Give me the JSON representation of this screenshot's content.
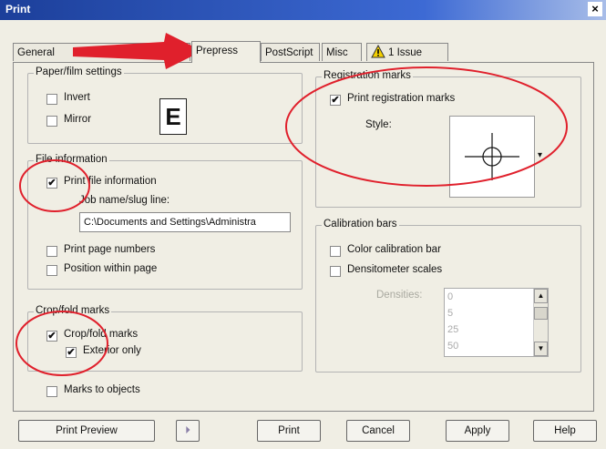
{
  "window": {
    "title": "Print",
    "close_glyph": "×"
  },
  "tabs": [
    {
      "label": "General"
    },
    {
      "label": "Prepress"
    },
    {
      "label": "PostScript"
    },
    {
      "label": "Misc"
    },
    {
      "label": "1 Issue"
    }
  ],
  "active_tab": "Prepress",
  "paper_film": {
    "title": "Paper/film settings",
    "invert": {
      "label": "Invert",
      "checked": false
    },
    "mirror": {
      "label": "Mirror",
      "checked": false
    },
    "preview_glyph": "E"
  },
  "file_info": {
    "title": "File information",
    "print_file_info": {
      "label": "Print file information",
      "checked": true
    },
    "job_name_label": "Job name/slug line:",
    "job_name_value": "C:\\Documents and Settings\\Administra",
    "print_page_numbers": {
      "label": "Print page numbers",
      "checked": false
    },
    "position_within_page": {
      "label": "Position within page",
      "checked": false
    }
  },
  "crop_fold": {
    "title": "Crop/fold marks",
    "crop_fold_marks": {
      "label": "Crop/fold marks",
      "checked": true
    },
    "exterior_only": {
      "label": "Exterior only",
      "checked": true
    }
  },
  "marks_to_objects": {
    "label": "Marks to objects",
    "checked": false
  },
  "registration": {
    "title": "Registration marks",
    "print_registration": {
      "label": "Print registration marks",
      "checked": true
    },
    "style_label": "Style:"
  },
  "calibration": {
    "title": "Calibration bars",
    "color_bar": {
      "label": "Color calibration bar",
      "checked": false
    },
    "densitometer": {
      "label": "Densitometer scales",
      "checked": false
    },
    "densities_label": "Densities:",
    "densities": [
      "0",
      "5",
      "25",
      "50"
    ]
  },
  "buttons": {
    "print_preview": "Print Preview",
    "print": "Print",
    "cancel": "Cancel",
    "apply": "Apply",
    "help": "Help"
  },
  "check_glyph": "✔",
  "colors": {
    "annotation": "#e0202c",
    "titlebar": "#1c3f9a"
  }
}
